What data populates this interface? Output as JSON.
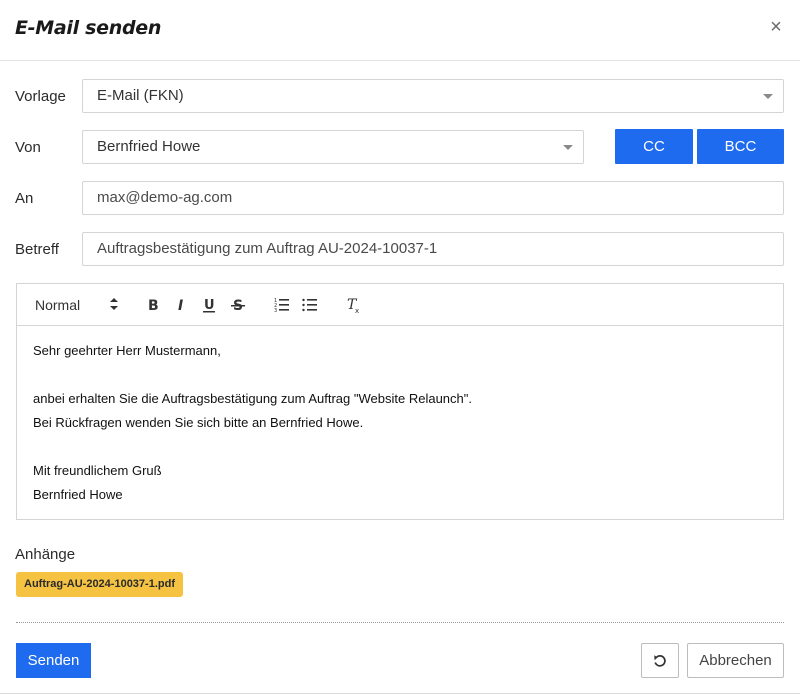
{
  "dialog": {
    "title": "E-Mail senden",
    "close_label": "×"
  },
  "form": {
    "template": {
      "label": "Vorlage",
      "value": "E-Mail (FKN)"
    },
    "from": {
      "label": "Von",
      "value": "Bernfried Howe"
    },
    "cc_label": "CC",
    "bcc_label": "BCC",
    "to": {
      "label": "An",
      "value": "max@demo-ag.com"
    },
    "subject": {
      "label": "Betreff",
      "value": "Auftragsbestätigung zum Auftrag AU-2024-10037-1"
    }
  },
  "editor": {
    "toolbar": {
      "format_select": "Normal",
      "icons": [
        "bold-icon",
        "italic-icon",
        "underline-icon",
        "strikethrough-icon",
        "ordered-list-icon",
        "bullet-list-icon",
        "clear-format-icon"
      ]
    },
    "body_lines": [
      "Sehr geehrter Herr Mustermann,",
      "",
      "anbei erhalten Sie die Auftragsbestätigung zum Auftrag \"Website Relaunch\".",
      "Bei Rückfragen wenden Sie sich bitte an Bernfried Howe.",
      "",
      "Mit freundlichem Gruß",
      "Bernfried Howe"
    ]
  },
  "attachments": {
    "label": "Anhänge",
    "files": [
      "Auftrag-AU-2024-10037-1.pdf"
    ]
  },
  "footer": {
    "send_label": "Senden",
    "cancel_label": "Abbrechen"
  },
  "colors": {
    "primary": "#1f6bf0",
    "attachment_chip": "#f5c242",
    "border": "#d4d4d4"
  }
}
